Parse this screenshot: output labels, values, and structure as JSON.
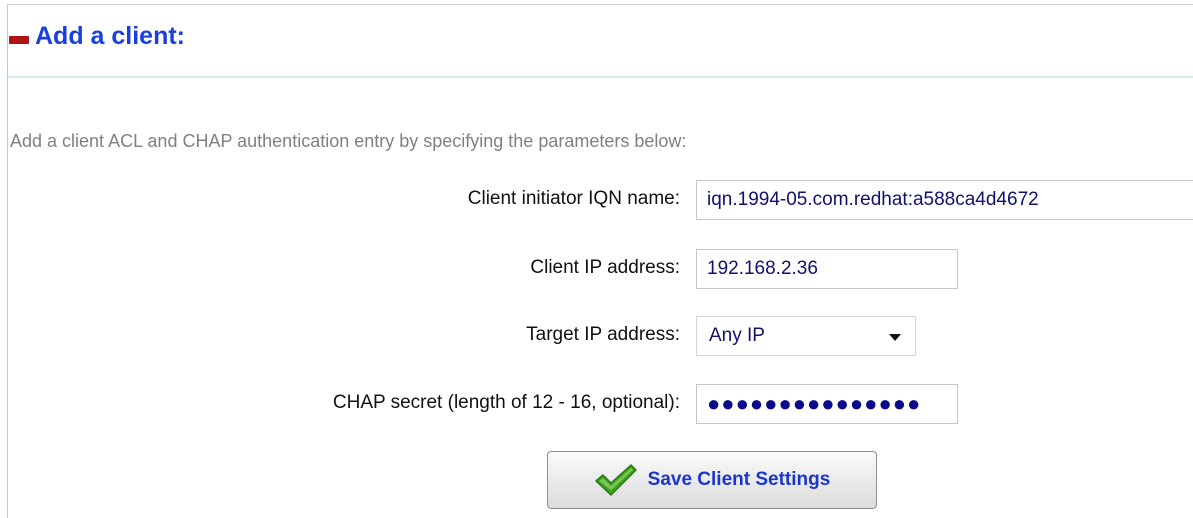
{
  "section": {
    "title": "Add a client:",
    "collapse_icon": "minus-collapse-icon"
  },
  "instructions": "Add a client ACL and CHAP authentication entry by specifying the parameters below:",
  "form": {
    "iqn": {
      "label": "Client initiator IQN name:",
      "value": "iqn.1994-05.com.redhat:a588ca4d4672"
    },
    "client_ip": {
      "label": "Client IP address:",
      "value": "192.168.2.36"
    },
    "target_ip": {
      "label": "Target IP address:",
      "selected": "Any IP"
    },
    "chap_secret": {
      "label": "CHAP secret (length of 12 - 16, optional):",
      "masked_value": "●●●●●●●●●●●●●●●"
    },
    "save_button": {
      "label": "Save Client Settings",
      "icon": "checkmark-icon"
    }
  },
  "colors": {
    "title": "#1a3fe0",
    "collapse_icon": "#b11217",
    "rule": "#d2ebf3",
    "instructions": "#808080",
    "field_text": "#101070",
    "button_text": "#1a36cf",
    "check": "#4caf28"
  }
}
